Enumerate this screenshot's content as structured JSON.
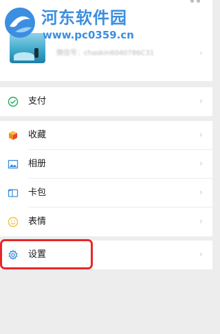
{
  "watermark": {
    "title": "河东软件园",
    "url": "www.pc0359.cn"
  },
  "profile": {
    "wechat_id": "微信号：chaskin6040786C31"
  },
  "menu": {
    "pay": {
      "label": "支付"
    },
    "favorites": {
      "label": "收藏"
    },
    "album": {
      "label": "相册"
    },
    "cards": {
      "label": "卡包"
    },
    "stickers": {
      "label": "表情"
    },
    "settings": {
      "label": "设置"
    }
  },
  "chevron": "›",
  "colors": {
    "pay_green": "#1aad5b",
    "fav_orange": "#f6a31b",
    "album_blue": "#3b8ed8",
    "cards_blue": "#3b8ed8",
    "stickers_yellow": "#f3c236",
    "settings_blue": "#3b8ed8",
    "highlight_red": "#e8262a",
    "watermark_blue": "#3c8ee0"
  }
}
